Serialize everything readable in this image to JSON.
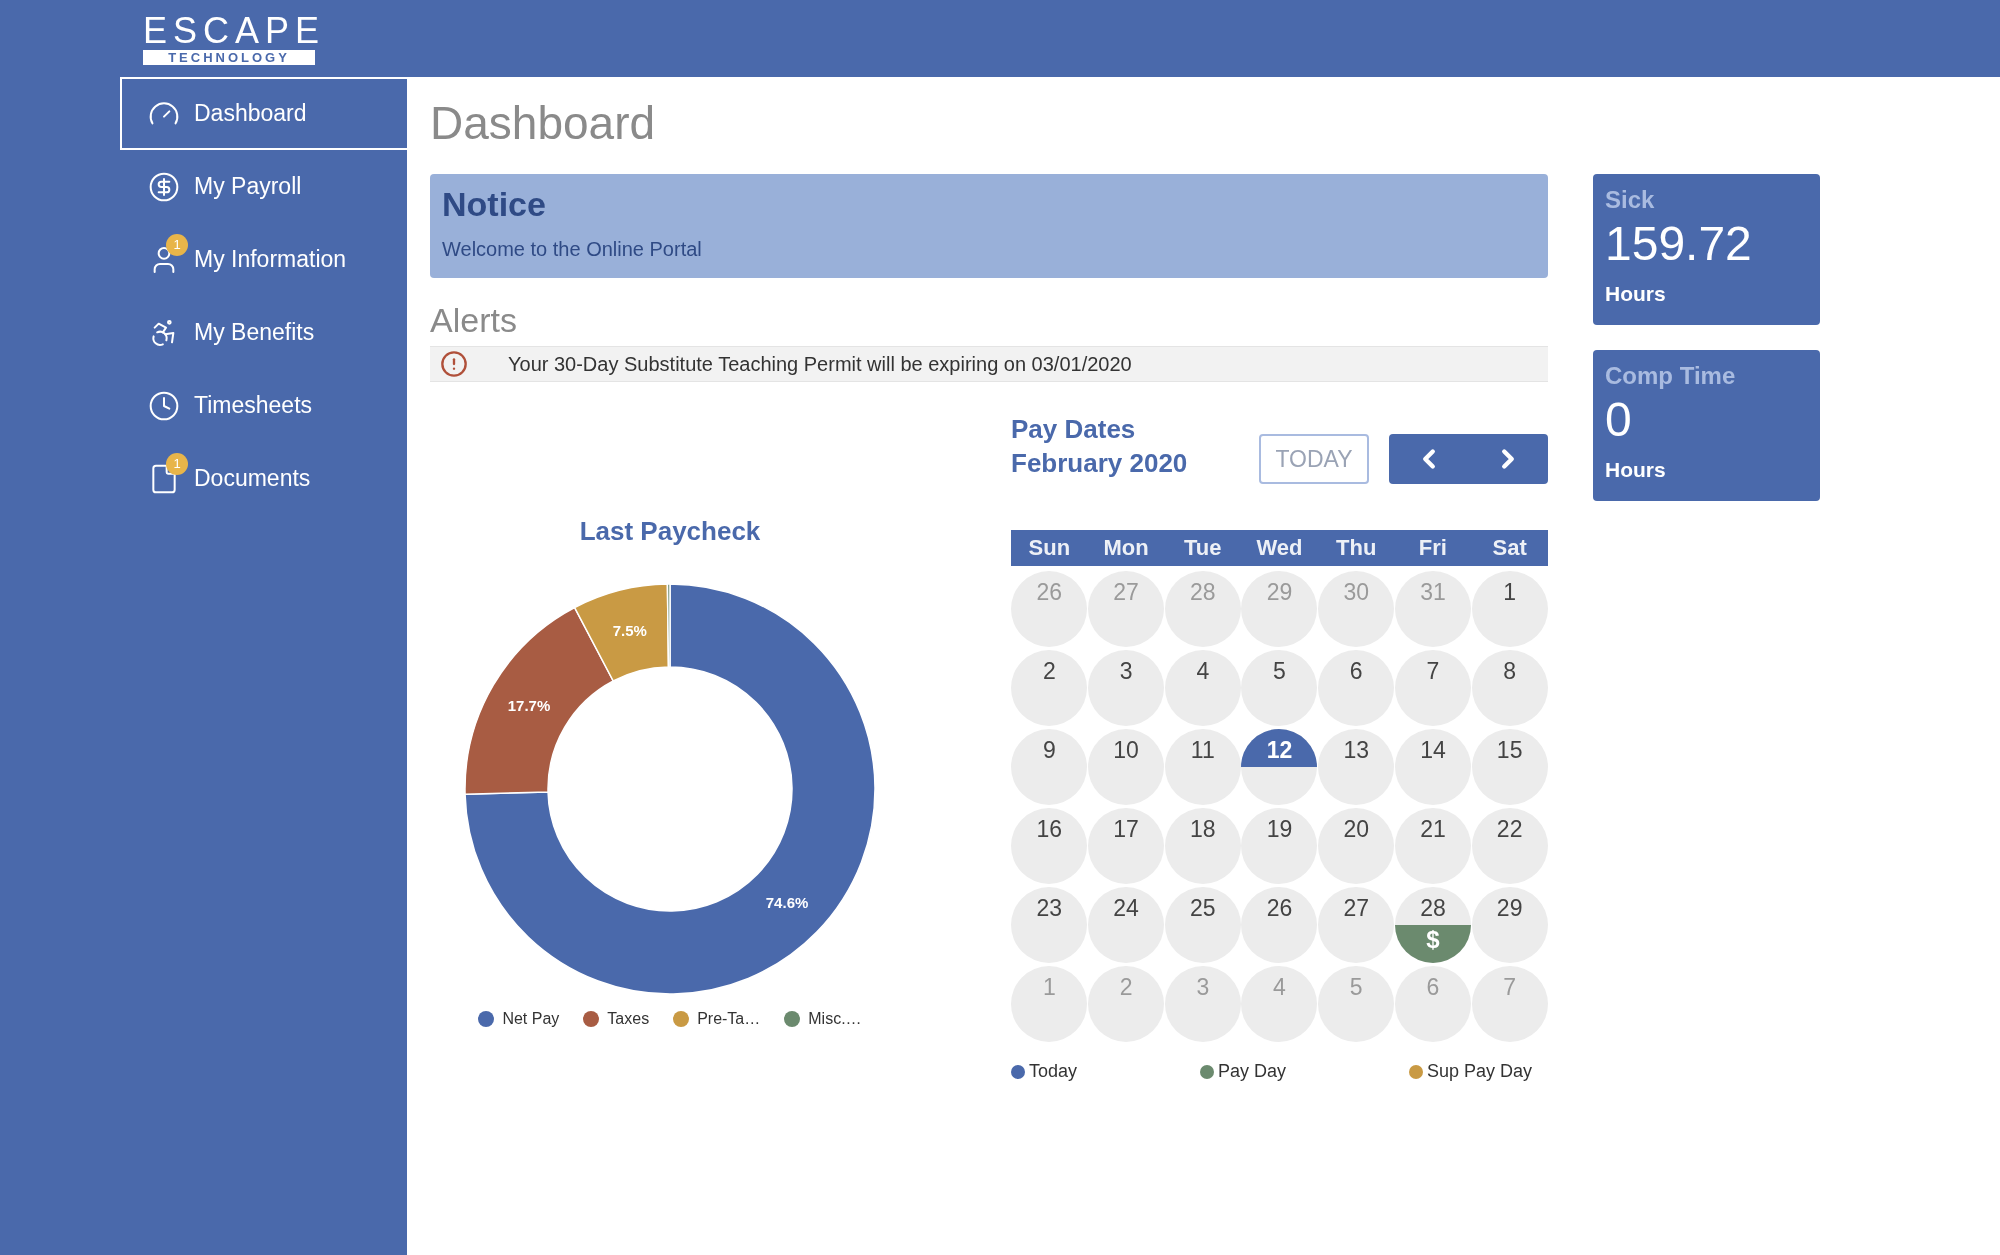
{
  "logo": {
    "word": "ESCAPE",
    "tagline": "TECHNOLOGY"
  },
  "sidebar": {
    "items": [
      {
        "label": "Dashboard",
        "selected": true
      },
      {
        "label": "My Payroll",
        "selected": false
      },
      {
        "label": "My Information",
        "selected": false,
        "badge": "1"
      },
      {
        "label": "My Benefits",
        "selected": false
      },
      {
        "label": "Timesheets",
        "selected": false
      },
      {
        "label": "Documents",
        "selected": false,
        "badge": "1"
      }
    ]
  },
  "page_title": "Dashboard",
  "notice": {
    "title": "Notice",
    "message": "Welcome to the Online Portal"
  },
  "alerts": {
    "title": "Alerts",
    "items": [
      {
        "text": "Your 30-Day Substitute Teaching Permit will be expiring on 03/01/2020"
      }
    ]
  },
  "last_paycheck": {
    "chart_data": {
      "type": "donut",
      "title": "Last Paycheck",
      "categories": [
        "Net Pay",
        "Taxes",
        "Pre-Ta…",
        "Misc.…"
      ],
      "series": [
        {
          "values": [
            74.6,
            17.7,
            7.5,
            0.2
          ]
        }
      ],
      "value_labels": [
        "74.6%",
        "17.7%",
        "7.5%",
        null
      ]
    },
    "legend": [
      {
        "color": "#4a69ab"
      },
      {
        "color": "#a85c43"
      },
      {
        "color": "#c99a44"
      },
      {
        "color": "#6b8a6e"
      }
    ]
  },
  "pay_dates": {
    "title": "Pay Dates",
    "month": "February 2020",
    "today_button": "TODAY",
    "weekdays": [
      "Sun",
      "Mon",
      "Tue",
      "Wed",
      "Thu",
      "Fri",
      "Sat"
    ],
    "weeks": [
      {
        "days": [
          {
            "day": "26",
            "kind": "muted"
          },
          {
            "day": "27",
            "kind": "muted"
          },
          {
            "day": "28",
            "kind": "muted"
          },
          {
            "day": "29",
            "kind": "muted"
          },
          {
            "day": "30",
            "kind": "muted"
          },
          {
            "day": "31",
            "kind": "muted"
          },
          {
            "day": "1",
            "kind": "plain"
          }
        ]
      },
      {
        "days": [
          {
            "day": "2",
            "kind": "plain"
          },
          {
            "day": "3",
            "kind": "plain"
          },
          {
            "day": "4",
            "kind": "plain"
          },
          {
            "day": "5",
            "kind": "plain"
          },
          {
            "day": "6",
            "kind": "plain"
          },
          {
            "day": "7",
            "kind": "plain"
          },
          {
            "day": "8",
            "kind": "plain"
          }
        ]
      },
      {
        "days": [
          {
            "day": "9",
            "kind": "plain"
          },
          {
            "day": "10",
            "kind": "plain"
          },
          {
            "day": "11",
            "kind": "plain"
          },
          {
            "day": "12",
            "kind": "today"
          },
          {
            "day": "13",
            "kind": "plain"
          },
          {
            "day": "14",
            "kind": "plain"
          },
          {
            "day": "15",
            "kind": "plain"
          }
        ]
      },
      {
        "days": [
          {
            "day": "16",
            "kind": "plain"
          },
          {
            "day": "17",
            "kind": "plain"
          },
          {
            "day": "18",
            "kind": "plain"
          },
          {
            "day": "19",
            "kind": "plain"
          },
          {
            "day": "20",
            "kind": "plain"
          },
          {
            "day": "21",
            "kind": "plain"
          },
          {
            "day": "22",
            "kind": "plain"
          }
        ]
      },
      {
        "days": [
          {
            "day": "23",
            "kind": "plain"
          },
          {
            "day": "24",
            "kind": "plain"
          },
          {
            "day": "25",
            "kind": "plain"
          },
          {
            "day": "26",
            "kind": "plain"
          },
          {
            "day": "27",
            "kind": "plain"
          },
          {
            "day": "28",
            "kind": "payday",
            "sign": "$"
          },
          {
            "day": "29",
            "kind": "plain"
          }
        ]
      },
      {
        "days": [
          {
            "day": "1",
            "kind": "muted"
          },
          {
            "day": "2",
            "kind": "muted"
          },
          {
            "day": "3",
            "kind": "muted"
          },
          {
            "day": "4",
            "kind": "muted"
          },
          {
            "day": "5",
            "kind": "muted"
          },
          {
            "day": "6",
            "kind": "muted"
          },
          {
            "day": "7",
            "kind": "muted"
          }
        ]
      }
    ],
    "legend": [
      {
        "label": "Today",
        "color": "#4a69ab"
      },
      {
        "label": "Pay Day",
        "color": "#6b8a6e"
      },
      {
        "label": "Sup Pay Day",
        "color": "#c99a44"
      }
    ]
  },
  "balances": [
    {
      "title": "Sick",
      "value": "159.72",
      "unit": "Hours"
    },
    {
      "title": "Comp Time",
      "value": "0",
      "unit": "Hours"
    }
  ]
}
